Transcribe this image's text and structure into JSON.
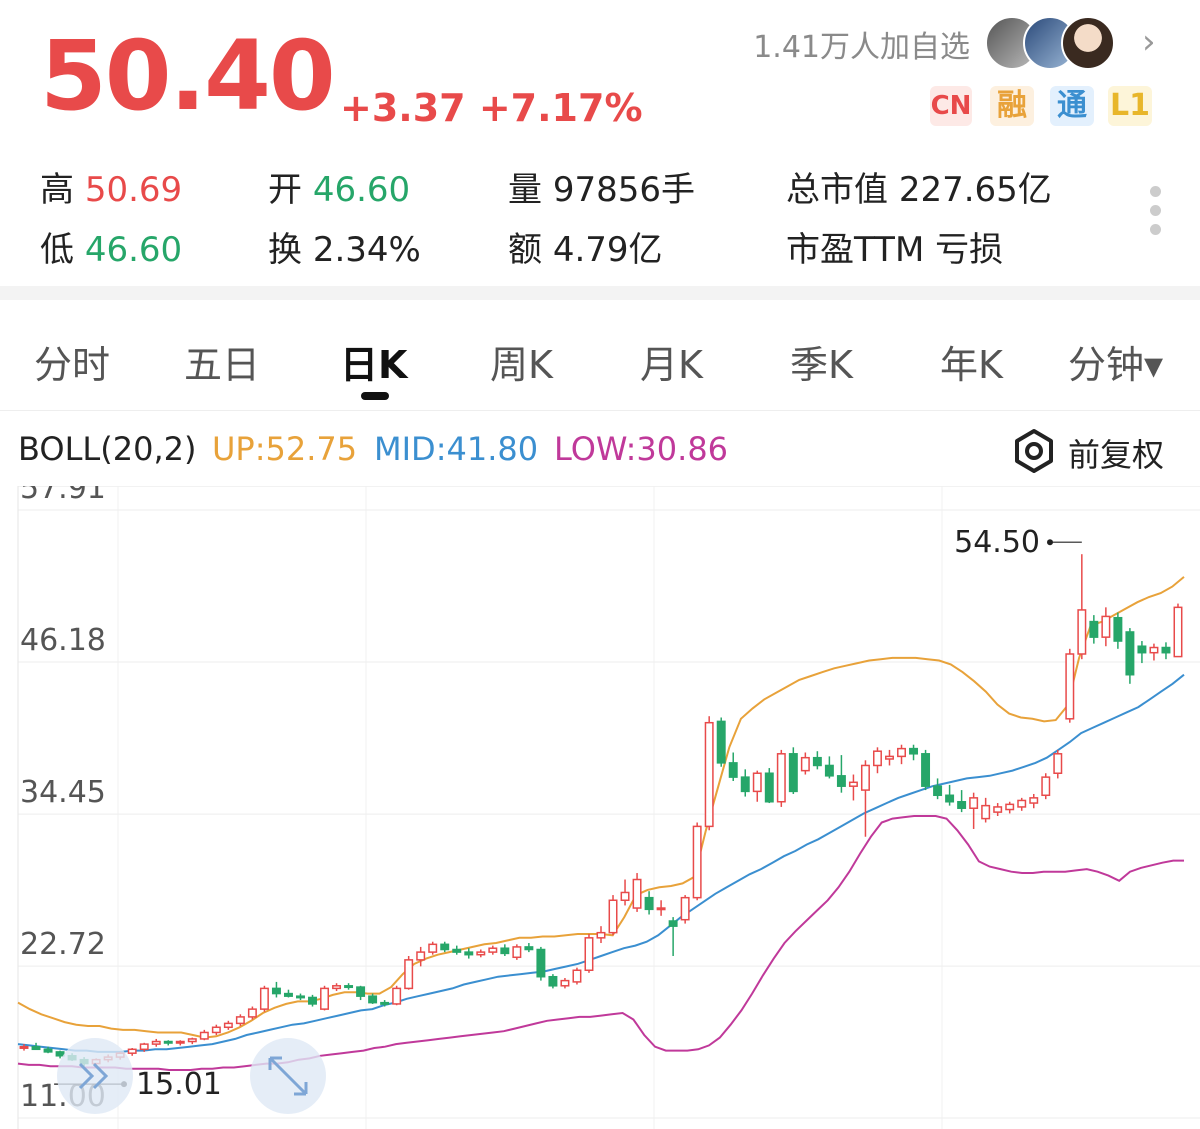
{
  "quote": {
    "price": "50.40",
    "change": "+3.37",
    "change_pct": "+7.17%",
    "followers": "1.41万人加自选",
    "badges": [
      "CN",
      "融",
      "通",
      "L1"
    ],
    "stats": {
      "high_label": "高",
      "high": "50.69",
      "low_label": "低",
      "low": "46.60",
      "open_label": "开",
      "open": "46.60",
      "turnover_label": "换",
      "turnover": "2.34%",
      "volume_label": "量",
      "volume": "97856手",
      "amount_label": "额",
      "amount": "4.79亿",
      "mktcap_label": "总市值",
      "mktcap": "227.65亿",
      "pe_label": "市盈TTM",
      "pe": "亏损"
    }
  },
  "colors": {
    "up": "#e84a4a",
    "down": "#26a669",
    "upper": "#e8a23a",
    "mid": "#3b8fd0",
    "lower": "#c0399a"
  },
  "tabs": [
    "分时",
    "五日",
    "日K",
    "周K",
    "月K",
    "季K",
    "年K",
    "分钟▾"
  ],
  "active_tab": "日K",
  "indicator": {
    "name": "BOLL(20,2)",
    "up": "UP:52.75",
    "mid": "MID:41.80",
    "low": "LOW:30.86",
    "adjust": "前复权"
  },
  "chart_data": {
    "type": "candlestick",
    "y_ticks": [
      "57.91",
      "46.18",
      "34.45",
      "22.72",
      "11.00"
    ],
    "ylim": [
      11.0,
      57.91
    ],
    "grid": true,
    "max_label": "54.50",
    "min_label": "15.01",
    "candles": [
      [
        16.4,
        16.7,
        16.2,
        16.5
      ],
      [
        16.5,
        16.8,
        16.3,
        16.3
      ],
      [
        16.3,
        16.5,
        16.0,
        16.1
      ],
      [
        16.1,
        16.2,
        15.6,
        15.8
      ],
      [
        15.8,
        16.0,
        15.4,
        15.5
      ],
      [
        15.5,
        15.7,
        15.0,
        15.2
      ],
      [
        15.2,
        15.6,
        15.01,
        15.5
      ],
      [
        15.5,
        15.9,
        15.3,
        15.7
      ],
      [
        15.7,
        16.1,
        15.5,
        16.0
      ],
      [
        16.0,
        16.4,
        15.8,
        16.3
      ],
      [
        16.3,
        16.8,
        16.1,
        16.7
      ],
      [
        16.7,
        17.1,
        16.5,
        16.9
      ],
      [
        16.9,
        17.0,
        16.6,
        16.8
      ],
      [
        16.8,
        17.0,
        16.6,
        16.9
      ],
      [
        16.9,
        17.2,
        16.7,
        17.1
      ],
      [
        17.1,
        17.8,
        17.0,
        17.6
      ],
      [
        17.6,
        18.2,
        17.4,
        18.0
      ],
      [
        18.0,
        18.5,
        17.8,
        18.3
      ],
      [
        18.3,
        19.0,
        18.1,
        18.8
      ],
      [
        18.8,
        19.6,
        18.6,
        19.4
      ],
      [
        19.4,
        21.2,
        19.2,
        21.0
      ],
      [
        21.0,
        21.5,
        20.3,
        20.6
      ],
      [
        20.6,
        20.9,
        20.3,
        20.4
      ],
      [
        20.4,
        20.6,
        20.1,
        20.3
      ],
      [
        20.3,
        20.5,
        19.6,
        19.8
      ],
      [
        19.4,
        21.2,
        19.3,
        21.0
      ],
      [
        21.0,
        21.4,
        20.8,
        21.2
      ],
      [
        21.2,
        21.4,
        20.9,
        21.1
      ],
      [
        21.1,
        21.2,
        20.1,
        20.4
      ],
      [
        20.4,
        20.6,
        19.8,
        19.9
      ],
      [
        19.9,
        20.1,
        19.6,
        19.8
      ],
      [
        19.8,
        21.2,
        19.7,
        21.0
      ],
      [
        21.0,
        23.5,
        20.9,
        23.2
      ],
      [
        23.2,
        24.2,
        22.7,
        23.8
      ],
      [
        23.8,
        24.6,
        23.6,
        24.4
      ],
      [
        24.4,
        24.6,
        23.8,
        24.0
      ],
      [
        24.0,
        24.3,
        23.6,
        23.8
      ],
      [
        23.8,
        24.1,
        23.3,
        23.6
      ],
      [
        23.6,
        24.0,
        23.4,
        23.8
      ],
      [
        23.8,
        24.3,
        23.6,
        24.1
      ],
      [
        24.1,
        24.4,
        23.5,
        23.7
      ],
      [
        23.4,
        24.4,
        23.2,
        24.2
      ],
      [
        24.2,
        24.5,
        23.8,
        24.0
      ],
      [
        24.0,
        24.2,
        21.6,
        21.9
      ],
      [
        21.9,
        22.1,
        21.0,
        21.2
      ],
      [
        21.2,
        21.8,
        21.0,
        21.6
      ],
      [
        21.5,
        22.6,
        21.3,
        22.4
      ],
      [
        22.4,
        25.2,
        22.2,
        24.9
      ],
      [
        24.9,
        25.8,
        24.5,
        25.3
      ],
      [
        25.3,
        28.2,
        25.1,
        27.8
      ],
      [
        27.8,
        29.4,
        27.4,
        28.4
      ],
      [
        27.2,
        29.9,
        26.9,
        29.4
      ],
      [
        28.0,
        28.5,
        26.7,
        27.1
      ],
      [
        27.1,
        27.8,
        26.6,
        27.2
      ],
      [
        26.2,
        26.5,
        23.5,
        25.8
      ],
      [
        26.3,
        28.2,
        26.0,
        28.0
      ],
      [
        28.0,
        33.8,
        27.8,
        33.5
      ],
      [
        33.5,
        42.0,
        33.2,
        41.5
      ],
      [
        41.6,
        41.9,
        38.1,
        38.4
      ],
      [
        38.4,
        39.2,
        37.0,
        37.3
      ],
      [
        37.3,
        37.9,
        35.8,
        36.2
      ],
      [
        36.2,
        37.8,
        35.4,
        37.6
      ],
      [
        37.6,
        38.0,
        35.3,
        35.4
      ],
      [
        35.4,
        39.4,
        35.0,
        39.1
      ],
      [
        39.1,
        39.6,
        36.0,
        36.2
      ],
      [
        37.8,
        39.2,
        37.5,
        38.8
      ],
      [
        38.8,
        39.3,
        37.9,
        38.2
      ],
      [
        38.2,
        38.9,
        37.2,
        37.4
      ],
      [
        37.4,
        39.0,
        36.1,
        36.6
      ],
      [
        36.6,
        37.5,
        35.5,
        36.9
      ],
      [
        36.3,
        38.6,
        32.7,
        38.2
      ],
      [
        38.2,
        39.6,
        37.6,
        39.3
      ],
      [
        38.7,
        39.4,
        38.2,
        38.9
      ],
      [
        38.9,
        39.8,
        38.3,
        39.5
      ],
      [
        39.5,
        39.8,
        38.6,
        39.1
      ],
      [
        39.1,
        39.4,
        36.3,
        36.6
      ],
      [
        36.6,
        37.2,
        35.6,
        35.9
      ],
      [
        35.9,
        36.7,
        35.1,
        35.4
      ],
      [
        35.4,
        36.3,
        34.6,
        34.9
      ],
      [
        34.9,
        36.1,
        33.3,
        35.7
      ],
      [
        34.1,
        35.7,
        33.8,
        35.1
      ],
      [
        34.6,
        35.3,
        34.3,
        35.0
      ],
      [
        34.8,
        35.4,
        34.5,
        35.2
      ],
      [
        35.0,
        35.7,
        34.7,
        35.5
      ],
      [
        35.3,
        36.0,
        34.9,
        35.7
      ],
      [
        35.9,
        37.6,
        35.6,
        37.3
      ],
      [
        37.6,
        39.4,
        37.2,
        39.1
      ],
      [
        41.8,
        47.2,
        41.5,
        46.8
      ],
      [
        46.8,
        54.5,
        46.4,
        50.2
      ],
      [
        49.3,
        49.8,
        47.6,
        48.1
      ],
      [
        48.1,
        50.4,
        47.4,
        49.7
      ],
      [
        49.6,
        50.0,
        47.2,
        47.8
      ],
      [
        48.5,
        48.8,
        44.5,
        45.2
      ],
      [
        47.4,
        47.8,
        46.1,
        46.9
      ],
      [
        46.9,
        47.6,
        46.3,
        47.3
      ],
      [
        47.3,
        47.7,
        46.4,
        46.9
      ],
      [
        46.6,
        50.69,
        46.6,
        50.4
      ]
    ],
    "upper": [
      19.9,
      19.4,
      19.0,
      18.7,
      18.4,
      18.2,
      18.1,
      18.1,
      17.9,
      17.8,
      17.8,
      17.7,
      17.6,
      17.6,
      17.6,
      17.4,
      17.2,
      17.3,
      17.6,
      18.0,
      18.5,
      19.1,
      19.5,
      19.8,
      20.0,
      20.0,
      20.2,
      20.5,
      20.7,
      20.7,
      20.6,
      20.6,
      21.1,
      22.1,
      22.9,
      23.3,
      23.6,
      23.8,
      24.0,
      24.2,
      24.4,
      24.5,
      24.7,
      24.9,
      24.9,
      25.0,
      25.0,
      25.1,
      25.2,
      25.2,
      25.2,
      25.1,
      26.5,
      28.2,
      28.6,
      28.8,
      28.9,
      29.1,
      29.6,
      33.2,
      36.4,
      39.6,
      41.8,
      42.6,
      43.3,
      43.8,
      44.3,
      44.8,
      45.1,
      45.4,
      45.7,
      45.9,
      46.1,
      46.3,
      46.4,
      46.5,
      46.5,
      46.5,
      46.4,
      46.3,
      46.0,
      45.4,
      44.7,
      43.9,
      42.9,
      42.2,
      41.9,
      41.8,
      41.6,
      41.7,
      42.8,
      46.5,
      49.0,
      49.3,
      49.8,
      50.3,
      50.8,
      51.2,
      51.5,
      52.0,
      52.75
    ],
    "mid": [
      16.7,
      16.6,
      16.5,
      16.4,
      16.3,
      16.2,
      16.2,
      16.1,
      16.1,
      16.1,
      16.2,
      16.2,
      16.3,
      16.3,
      16.4,
      16.5,
      16.6,
      16.7,
      16.9,
      17.1,
      17.4,
      17.6,
      17.8,
      18.0,
      18.2,
      18.3,
      18.5,
      18.7,
      18.9,
      19.1,
      19.3,
      19.4,
      19.7,
      19.9,
      20.2,
      20.4,
      20.6,
      20.8,
      21.0,
      21.3,
      21.5,
      21.7,
      21.9,
      22.0,
      22.1,
      22.2,
      22.3,
      22.5,
      22.7,
      22.9,
      23.2,
      23.5,
      23.8,
      24.1,
      24.3,
      24.6,
      25.1,
      25.8,
      26.5,
      27.1,
      27.7,
      28.3,
      28.8,
      29.3,
      29.8,
      30.2,
      30.7,
      31.2,
      31.6,
      32.1,
      32.5,
      33.0,
      33.5,
      34.0,
      34.5,
      34.9,
      35.3,
      35.7,
      36.0,
      36.3,
      36.6,
      36.8,
      37.0,
      37.2,
      37.3,
      37.4,
      37.6,
      37.8,
      38.1,
      38.4,
      38.8,
      39.4,
      40.0,
      40.7,
      41.1,
      41.5,
      41.9,
      42.3,
      42.7,
      43.3,
      43.9,
      44.5,
      45.2
    ],
    "lower": [
      15.2,
      15.1,
      15.1,
      15.0,
      15.0,
      15.0,
      14.9,
      14.9,
      14.9,
      14.9,
      14.8,
      14.8,
      14.8,
      14.8,
      14.7,
      14.7,
      14.7,
      14.8,
      14.8,
      14.9,
      14.9,
      15.0,
      15.1,
      15.2,
      15.2,
      15.3,
      15.5,
      15.6,
      15.8,
      15.9,
      16.0,
      16.1,
      16.2,
      16.4,
      16.5,
      16.7,
      16.8,
      16.9,
      17.0,
      17.1,
      17.2,
      17.3,
      17.4,
      17.5,
      17.6,
      17.7,
      17.9,
      18.1,
      18.3,
      18.5,
      18.6,
      18.7,
      18.8,
      18.8,
      18.9,
      19.0,
      19.1,
      18.6,
      17.4,
      16.5,
      16.2,
      16.2,
      16.2,
      16.3,
      16.6,
      17.2,
      18.2,
      19.3,
      20.6,
      22.0,
      23.3,
      24.5,
      25.4,
      26.2,
      27.0,
      27.8,
      28.8,
      30.0,
      31.4,
      32.7,
      33.8,
      34.1,
      34.2,
      34.3,
      34.3,
      34.3,
      34.1,
      33.2,
      32.1,
      30.8,
      30.4,
      30.2,
      30.0,
      29.9,
      29.9,
      30.0,
      30.0,
      30.0,
      30.1,
      30.2,
      30.0,
      29.7,
      29.3,
      30.0,
      30.3,
      30.5,
      30.7,
      30.86,
      30.86
    ]
  }
}
